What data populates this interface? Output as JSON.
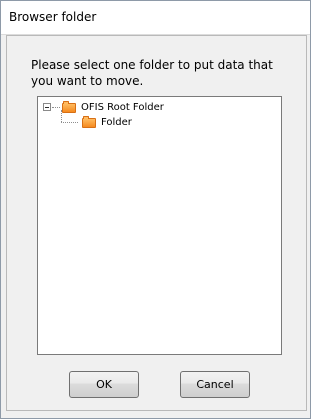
{
  "window": {
    "title": "Browser folder"
  },
  "dialog": {
    "instruction": "Please select one folder to put data that you want to move."
  },
  "tree": {
    "root": {
      "label": "OFIS Root Folder",
      "expanded": true,
      "icon": "folder-icon"
    },
    "children": [
      {
        "label": "Folder",
        "icon": "folder-icon"
      }
    ]
  },
  "buttons": {
    "ok_label": "OK",
    "cancel_label": "Cancel"
  }
}
